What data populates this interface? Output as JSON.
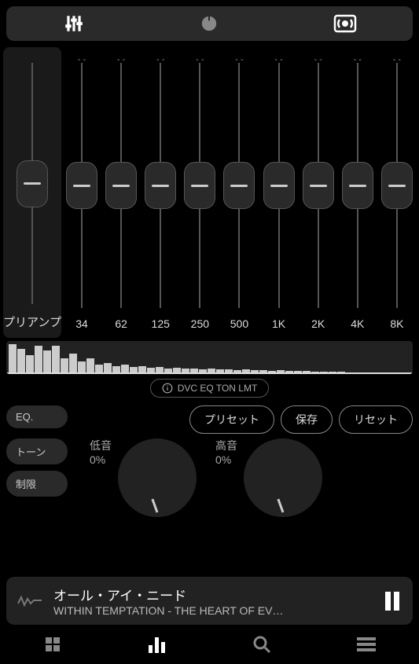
{
  "eq": {
    "preamp_label": "プリアンプ",
    "bands": [
      "34",
      "62",
      "125",
      "250",
      "500",
      "1K",
      "2K",
      "4K",
      "8K"
    ]
  },
  "status_text": "DVC EQ TON LMT",
  "toggles": {
    "eq": "EQ.",
    "tone": "トーン",
    "limit": "制限"
  },
  "buttons": {
    "preset": "プリセット",
    "save": "保存",
    "reset": "リセット"
  },
  "knobs": {
    "bass_label": "低音",
    "bass_value": "0%",
    "treble_label": "高音",
    "treble_value": "0%"
  },
  "now_playing": {
    "title": "オール・アイ・ニード",
    "subtitle": "WITHIN TEMPTATION - THE HEART OF EV…"
  },
  "viz_bars": [
    36,
    30,
    22,
    34,
    28,
    34,
    18,
    24,
    14,
    18,
    10,
    12,
    8,
    10,
    7,
    8,
    6,
    7,
    5,
    6,
    5,
    5,
    4,
    5,
    4,
    4,
    3,
    4,
    3,
    3,
    2,
    3,
    2,
    2,
    2,
    1,
    1,
    1,
    1
  ]
}
